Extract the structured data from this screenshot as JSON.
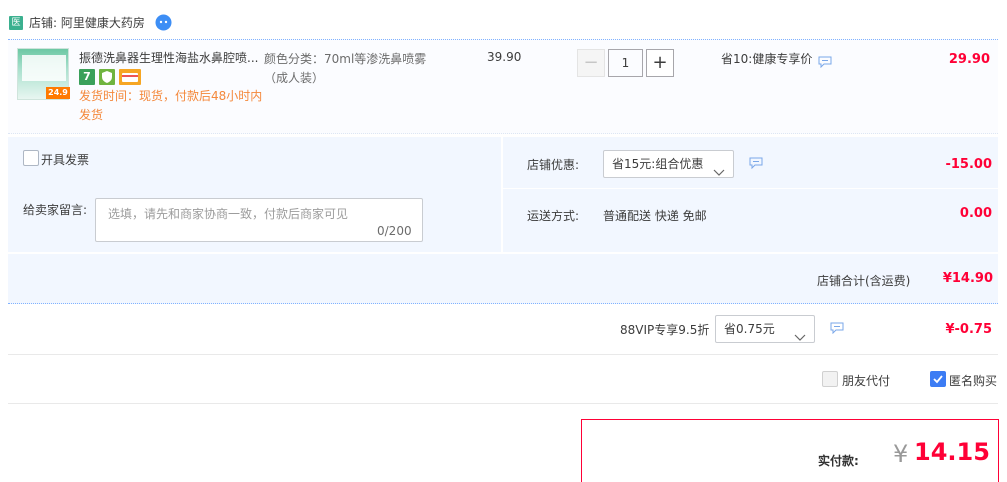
{
  "shop": {
    "badge": "医",
    "label": "店铺: 阿里健康大药房"
  },
  "item": {
    "title": "振德洗鼻器生理性海盐水鼻腔喷...",
    "thumb_badge": "24.9",
    "service_icons": [
      "7",
      "shield",
      "card"
    ],
    "ship_time": "发货时间：现货，付款后48小时内发货",
    "sku": "颜色分类：70ml等渗洗鼻喷雾（成人装）",
    "unit_price": "39.90",
    "quantity": "1",
    "qty_minus": "−",
    "qty_plus": "+",
    "promo": "省10:健康专享价",
    "total": "29.90"
  },
  "options": {
    "invoice_label": "开具发票",
    "message_label": "给卖家留言:",
    "message_placeholder": "选填，请先和商家协商一致，付款后商家可见",
    "message_count": "0/200",
    "shop_discount_label": "店铺优惠:",
    "shop_discount_selected": "省15元:组合优惠",
    "shop_discount_value": "-15.00",
    "shipping_label": "运送方式:",
    "shipping_method": "普通配送 快递 免邮",
    "shipping_value": "0.00"
  },
  "shop_total": {
    "label": "店铺合计(含运费)",
    "value": "¥14.90"
  },
  "vip": {
    "label": "88VIP专享9.5折",
    "selected": "省0.75元",
    "value": "¥-0.75"
  },
  "extras": {
    "friend_pay_label": "朋友代付",
    "anonymous_label": "匿名购买",
    "anonymous_checked": true
  },
  "payment": {
    "label": "实付款:",
    "currency": "¥",
    "amount": "14.15"
  },
  "colors": {
    "accent_red": "#ff0036",
    "panel_bg": "#f2f7ff",
    "check_blue": "#3c7cf4",
    "ship_orange": "#f4883b"
  }
}
